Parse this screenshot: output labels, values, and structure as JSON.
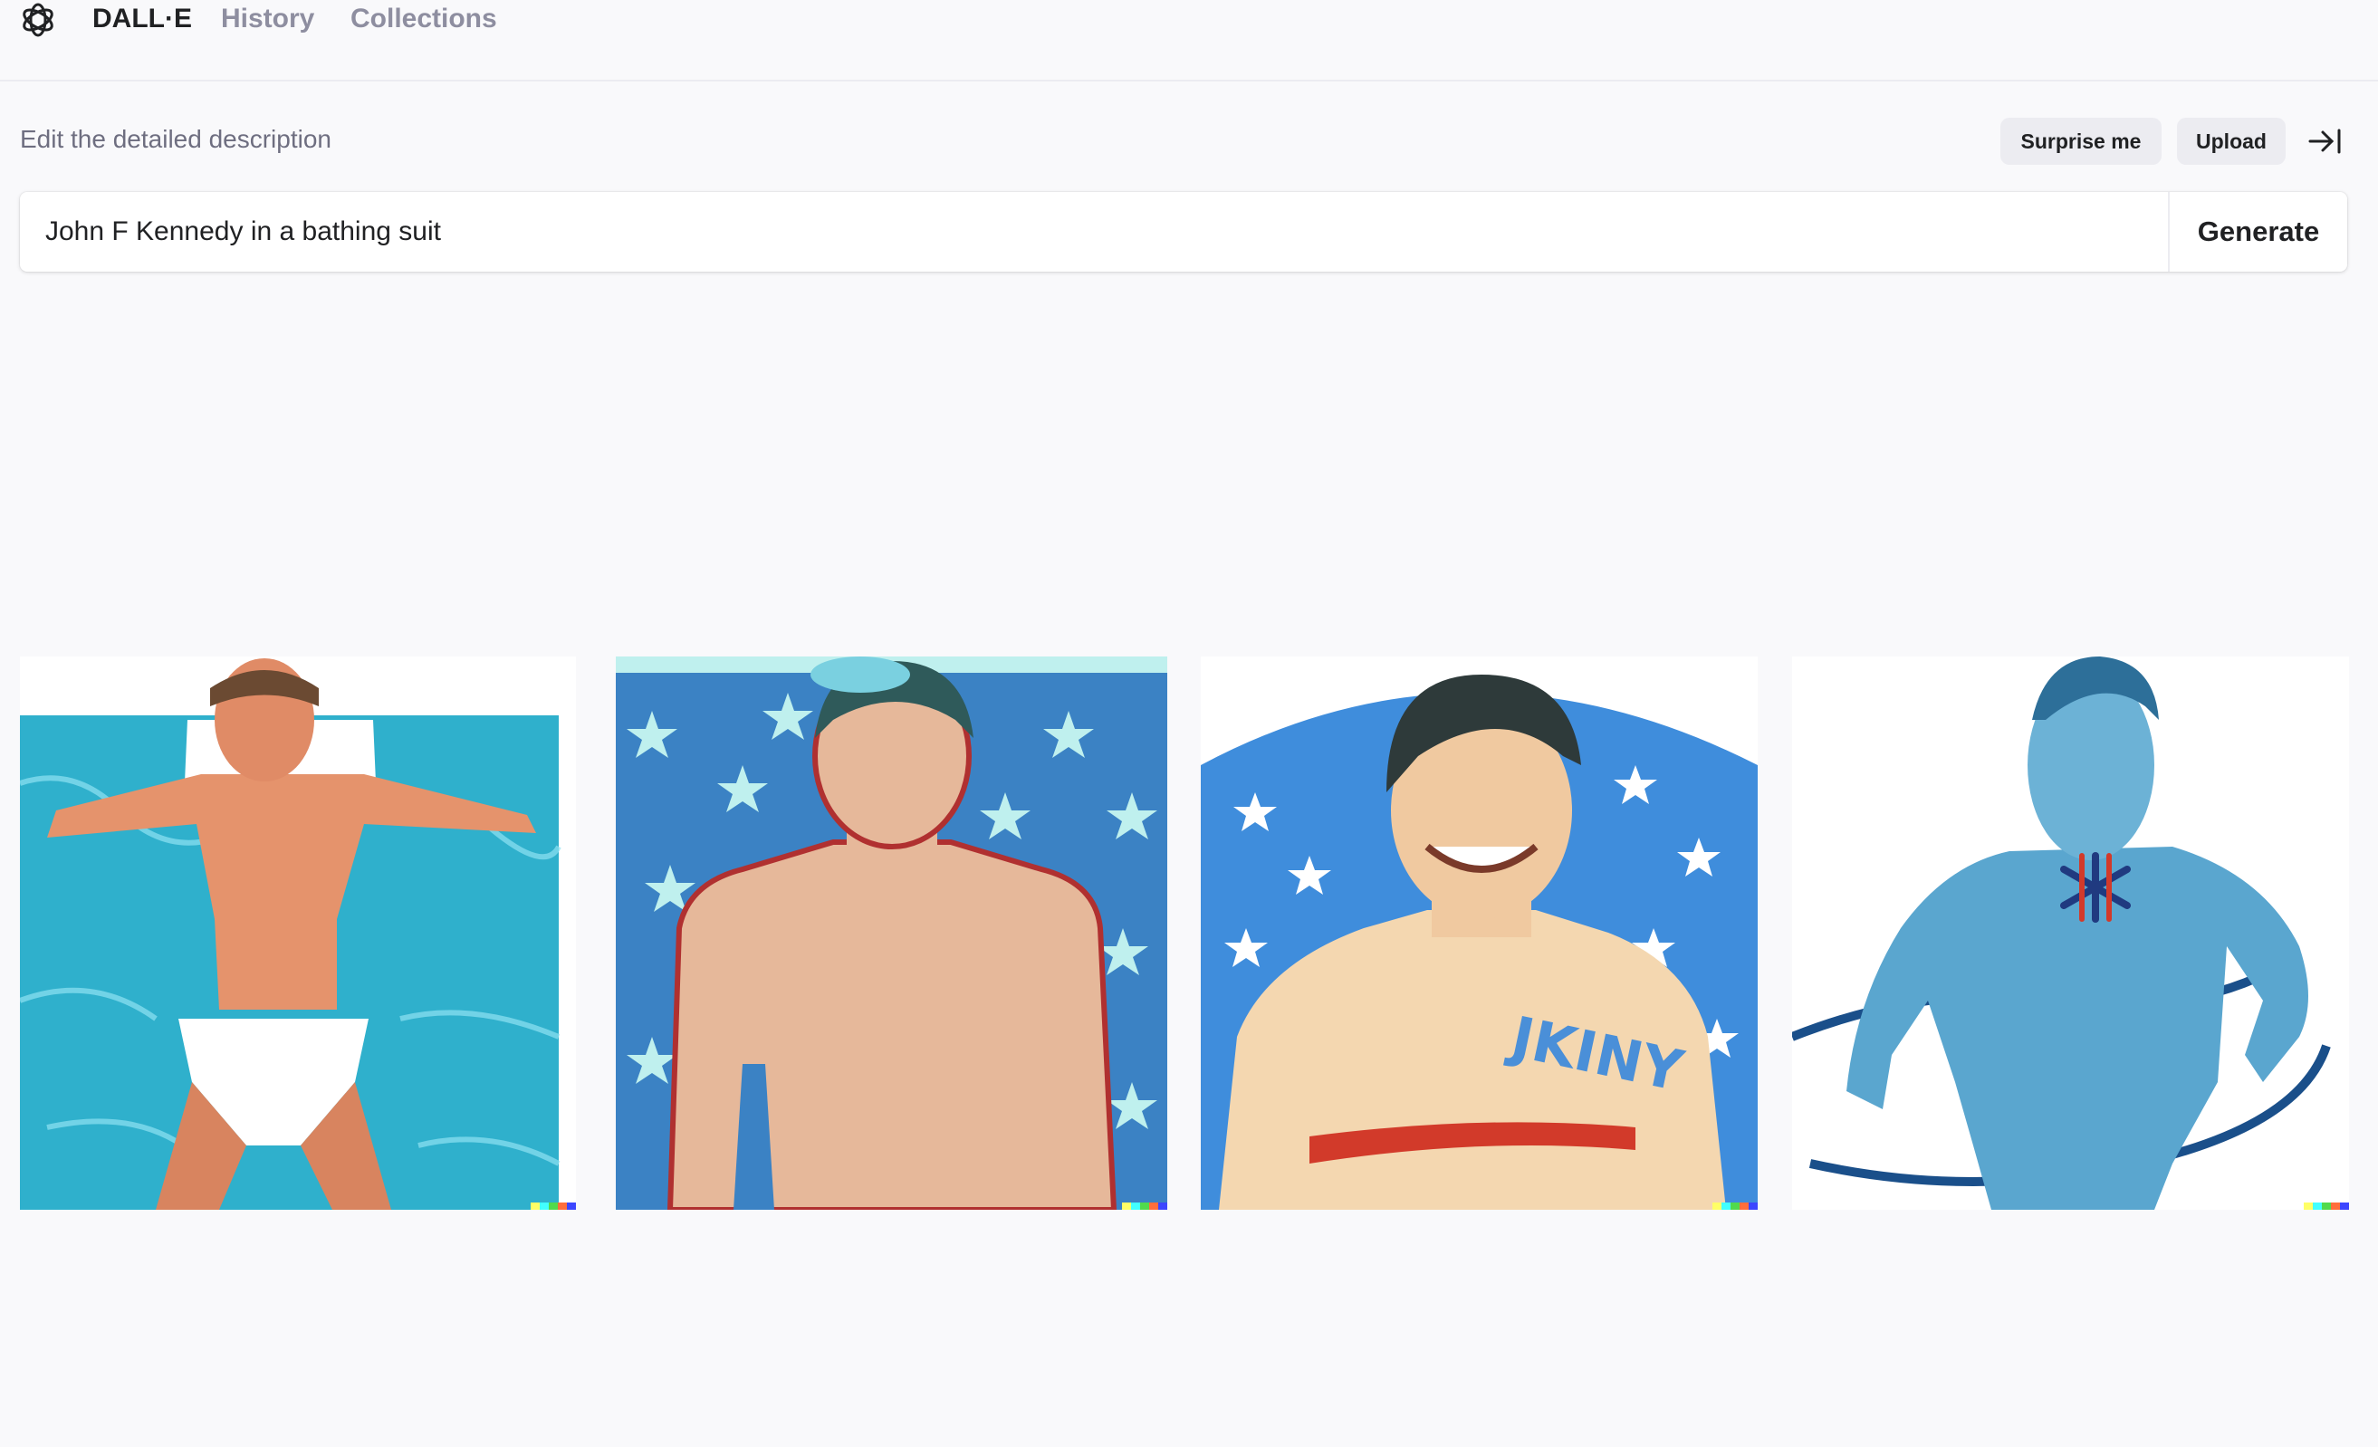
{
  "nav": {
    "brand": "DALL·E",
    "links": [
      "History",
      "Collections"
    ]
  },
  "editor": {
    "label": "Edit the detailed description",
    "surprise_label": "Surprise me",
    "upload_label": "Upload",
    "prompt_value": "John F Kennedy in a bathing suit",
    "generate_label": "Generate"
  },
  "results": {
    "image_3_chest_text": "JKINY"
  },
  "colors": {
    "signature": [
      "#ffff66",
      "#42ffff",
      "#51da4c",
      "#ff6e3c",
      "#3c46ff"
    ]
  }
}
